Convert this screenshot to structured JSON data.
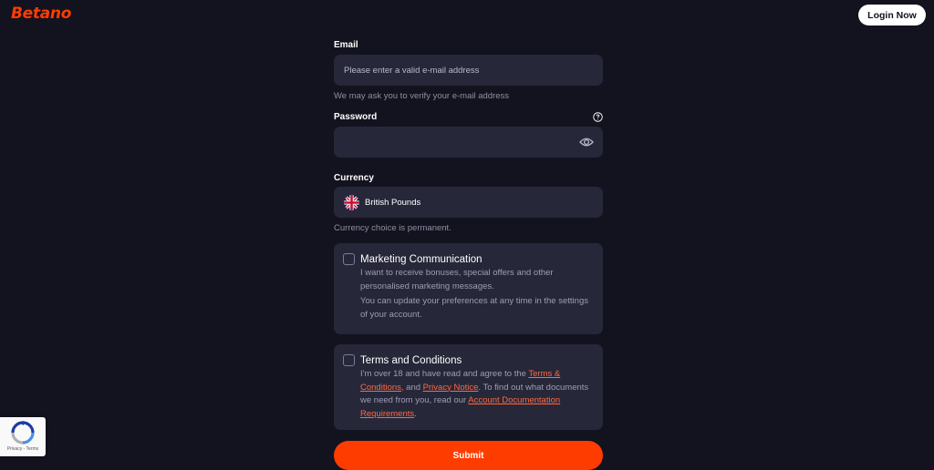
{
  "header": {
    "logo": "Betano",
    "login_label": "Login Now"
  },
  "form": {
    "email": {
      "label": "Email",
      "placeholder": "Please enter a valid e-mail address",
      "hint": "We may ask you to verify your e-mail address"
    },
    "password": {
      "label": "Password",
      "value": ""
    },
    "currency": {
      "label": "Currency",
      "selected": "British Pounds",
      "hint": "Currency choice is permanent."
    },
    "marketing": {
      "title": "Marketing Communication",
      "text1": "I want to receive bonuses, special offers and other personalised marketing messages.",
      "text2": "You can update your preferences at any time in the settings of your account.",
      "checked": false
    },
    "terms": {
      "title": "Terms and Conditions",
      "text_a": "I'm over 18 and have read and agree to the ",
      "link_terms": "Terms & Conditions,",
      "text_b": " and ",
      "link_privacy": "Privacy Notice",
      "text_c": ". To find out what documents we need from you, read our ",
      "link_docs": "Account Documentation Requirements",
      "text_d": ".",
      "checked": false
    },
    "submit_label": "Submit"
  },
  "recaptcha": {
    "text": "Privacy - Terms"
  },
  "colors": {
    "background": "#13121f",
    "brand": "#ff3c00",
    "field": "#27273a",
    "link": "#ff6a3d"
  }
}
